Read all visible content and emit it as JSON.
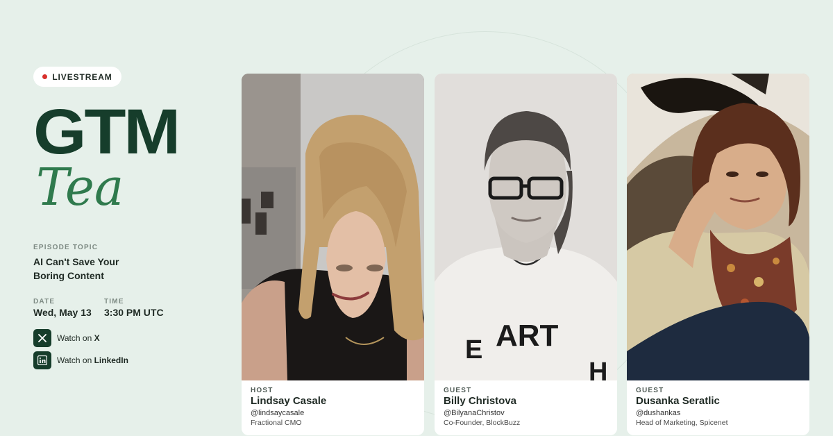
{
  "badge": {
    "label": "LIVESTREAM",
    "dot_color": "#d8302c"
  },
  "title": {
    "main": "GTM",
    "script": "Tea"
  },
  "episode": {
    "label": "EPISODE TOPIC",
    "topic": "AI Can't Save Your Boring Content"
  },
  "schedule": {
    "date_label": "DATE",
    "date": "Wed, May 13",
    "time_label": "TIME",
    "time": "3:30 PM UTC"
  },
  "watch": [
    {
      "prefix": "Watch on",
      "platform": "X",
      "icon": "x-logo-icon"
    },
    {
      "prefix": "Watch on",
      "platform": "LinkedIn",
      "icon": "linkedin-logo-icon"
    }
  ],
  "speakers": [
    {
      "role": "HOST",
      "name": "Lindsay Casale",
      "handle": "@lindsaycasale",
      "title": "Fractional CMO"
    },
    {
      "role": "GUEST",
      "name": "Billy Christova",
      "handle": "@BilyanaChristov",
      "title": "Co-Founder, BlockBuzz",
      "shirt_text": "E ART H"
    },
    {
      "role": "GUEST",
      "name": "Dusanka Seratlic",
      "handle": "@dushankas",
      "title": "Head of Marketing, Spicenet"
    }
  ],
  "colors": {
    "background": "#e6f0ea",
    "brand_dark": "#163d2b",
    "brand_green": "#2f7a4d"
  }
}
